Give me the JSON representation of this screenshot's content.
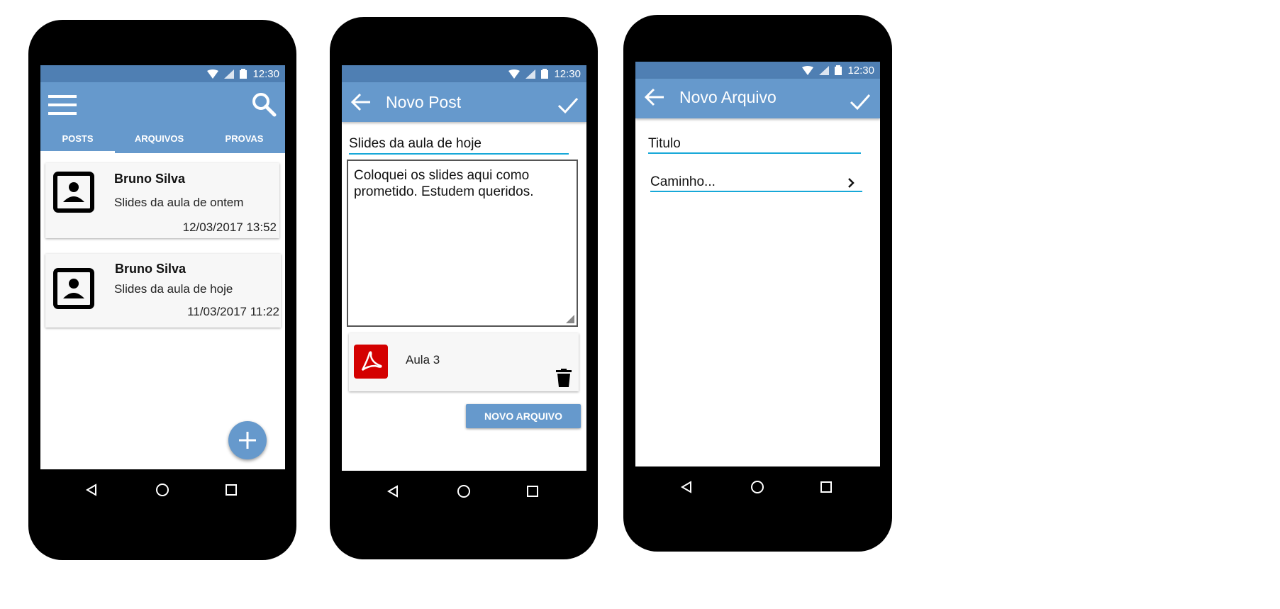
{
  "status": {
    "time": "12:30"
  },
  "screen1": {
    "tabs": [
      {
        "label": "POSTS",
        "active": true
      },
      {
        "label": "ARQUIVOS",
        "active": false
      },
      {
        "label": "PROVAS",
        "active": false
      }
    ],
    "posts": [
      {
        "author": "Bruno Silva",
        "title": "Slides da aula de ontem",
        "date": "12/03/2017 13:52"
      },
      {
        "author": "Bruno Silva",
        "title": "Slides da aula de hoje",
        "date": "11/03/2017 11:22"
      }
    ],
    "fab_icon": "plus-icon"
  },
  "screen2": {
    "title": "Novo Post",
    "post_title": "Slides da aula de hoje",
    "post_body": "Coloquei os slides aqui como prometido. Estudem queridos.",
    "attachment": {
      "name": "Aula 3",
      "icon": "pdf-icon"
    },
    "new_file_button": "NOVO ARQUIVO"
  },
  "screen3": {
    "title": "Novo Arquivo",
    "titulo_placeholder": "Titulo",
    "caminho_placeholder": "Caminho..."
  },
  "colors": {
    "primary": "#6699cc",
    "status": "#4f7fb3",
    "accent": "#17a8d8",
    "pdf": "#d40000"
  }
}
